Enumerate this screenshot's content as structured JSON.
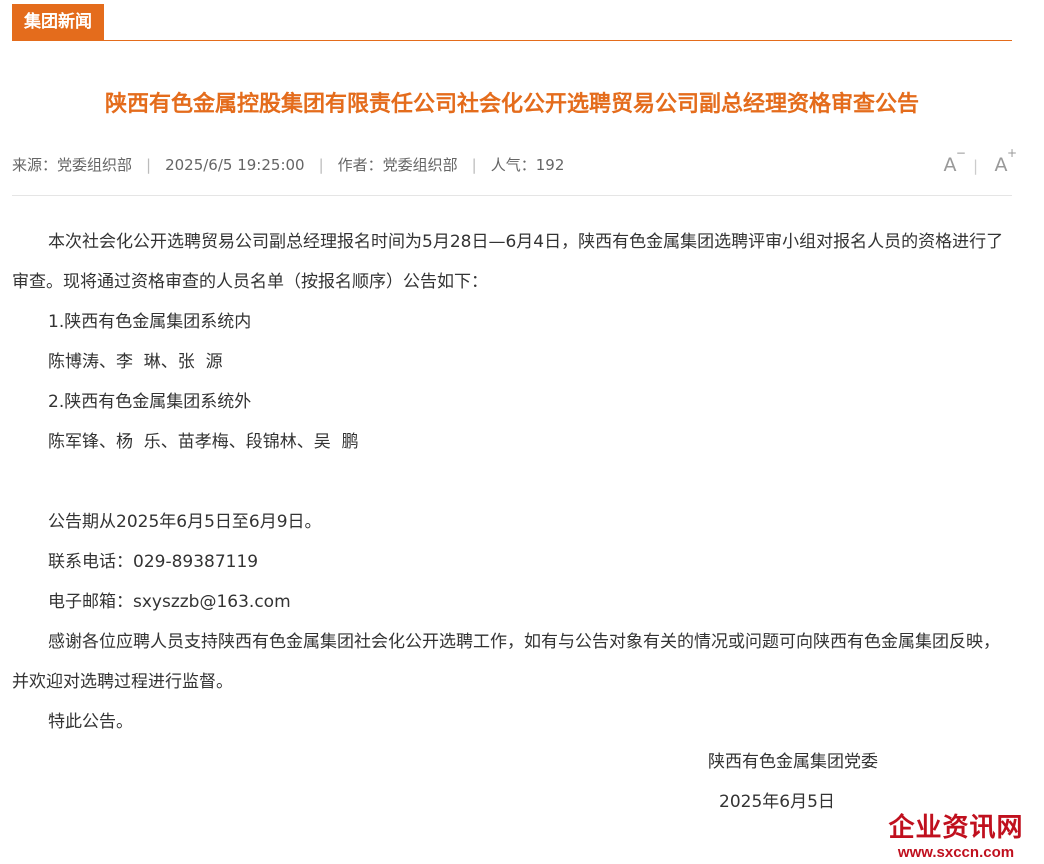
{
  "section": {
    "tab_label": "集团新闻"
  },
  "article": {
    "title": "陕西有色金属控股集团有限责任公司社会化公开选聘贸易公司副总经理资格审查公告",
    "meta": {
      "source": "来源：党委组织部",
      "datetime": "2025/6/5 19:25:00",
      "author": "作者：党委组织部",
      "views": "人气：192",
      "separator": "|"
    },
    "font_controls": {
      "decrease_label": "A",
      "decrease_sup": "−",
      "increase_label": "A",
      "increase_sup": "+",
      "separator": "|"
    },
    "body": {
      "intro": "本次社会化公开选聘贸易公司副总经理报名时间为5月28日—6月4日，陕西有色金属集团选聘评审小组对报名人员的资格进行了审查。现将通过资格审查的人员名单（按报名顺序）公告如下：",
      "group1_heading": "1.陕西有色金属集团系统内",
      "group1_names": "陈博涛、李  琳、张  源",
      "group2_heading": "2.陕西有色金属集团系统外",
      "group2_names": "陈军锋、杨  乐、苗孝梅、段锦林、吴  鹏",
      "period": "公告期从2025年6月5日至6月9日。",
      "phone": "联系电话：029-89387119",
      "email": "电子邮箱：sxyszzb@163.com",
      "thanks": "感谢各位应聘人员支持陕西有色金属集团社会化公开选聘工作，如有与公告对象有关的情况或问题可向陕西有色金属集团反映，并欢迎对选聘过程进行监督。",
      "closing": "特此公告。"
    },
    "signature": {
      "org": "陕西有色金属集团党委",
      "date": "2025年6月5日"
    }
  },
  "watermark": {
    "name": "企业资讯网",
    "url": "www.sxccn.com"
  },
  "colors": {
    "accent": "#e46c1c",
    "text": "#333333",
    "meta": "#666666",
    "watermark": "#c0101e"
  }
}
